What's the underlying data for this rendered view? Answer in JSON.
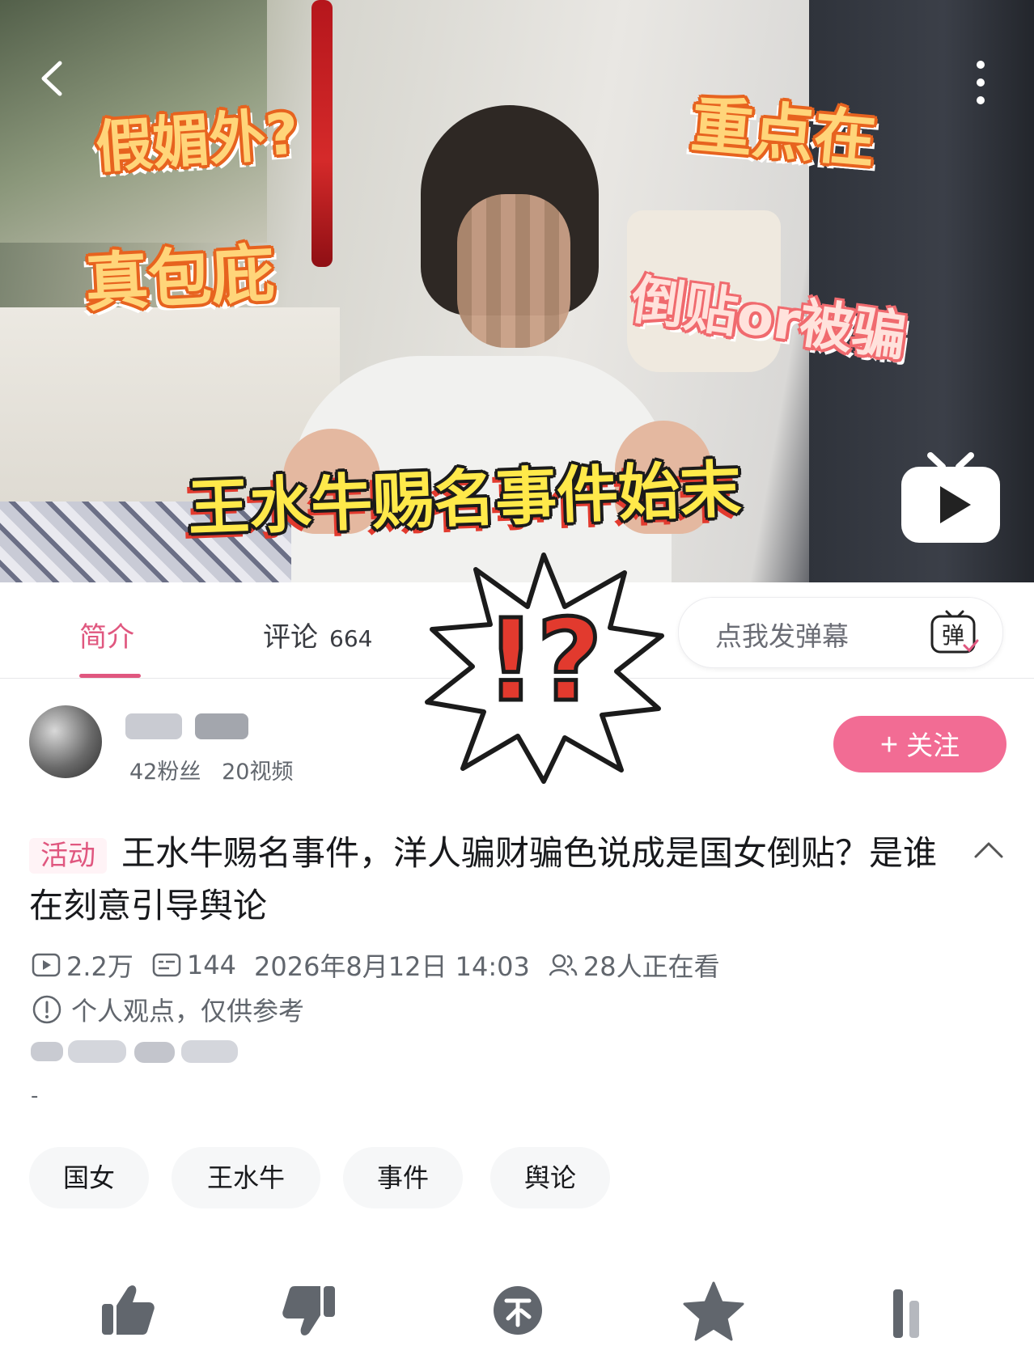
{
  "video": {
    "captions": {
      "top_left": "假媚外?",
      "left_mid": "真包庇",
      "top_right": "重点在",
      "right_mid": "倒贴or被骗",
      "bottom": "王水牛赐名事件始末"
    }
  },
  "tabs": {
    "intro_label": "简介",
    "comments_label": "评论",
    "comments_count": "664"
  },
  "danmu": {
    "placeholder": "点我发弹幕",
    "icon_glyph": "弹"
  },
  "overlay": {
    "text": "!?"
  },
  "uploader": {
    "followers": "42粉丝",
    "videos": "20视频",
    "follow_label": "关注",
    "follow_plus": "+"
  },
  "post": {
    "activity_badge": "活动",
    "title": "王水牛赐名事件，洋人骗财骗色说成是国女倒贴？是谁在刻意引导舆论",
    "views": "2.2万",
    "danmaku_count": "144",
    "datetime": "2026年8月12日 14:03",
    "watching": "28人正在看",
    "notice": "个人观点，仅供参考",
    "dash": "-"
  },
  "tags": [
    "国女",
    "王水牛",
    "事件",
    "舆论"
  ],
  "colors": {
    "accent_pink": "#e0577f",
    "follow_pink": "#f26c94",
    "text_gray": "#61666d"
  }
}
